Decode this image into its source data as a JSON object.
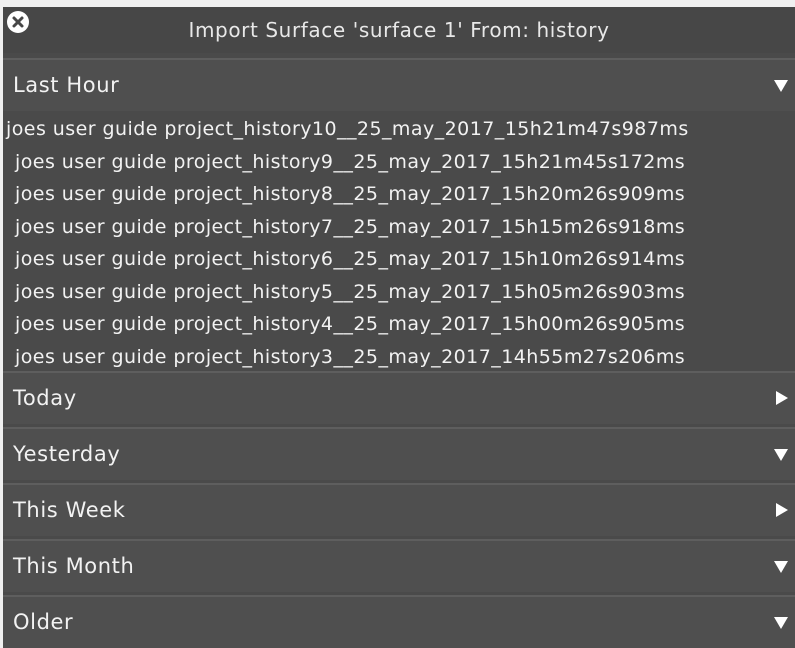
{
  "dialog": {
    "title": "Import Surface 'surface 1' From: history",
    "close_icon": "close-circle-icon"
  },
  "sections": [
    {
      "label": "Last Hour",
      "expanded": true,
      "arrow_icon": "triangle-down-icon",
      "items": [
        "joes user guide project_history10__25_may_2017_15h21m47s987ms",
        "joes user guide project_history9__25_may_2017_15h21m45s172ms",
        "joes user guide project_history8__25_may_2017_15h20m26s909ms",
        "joes user guide project_history7__25_may_2017_15h15m26s918ms",
        "joes user guide project_history6__25_may_2017_15h10m26s914ms",
        "joes user guide project_history5__25_may_2017_15h05m26s903ms",
        "joes user guide project_history4__25_may_2017_15h00m26s905ms",
        "joes user guide project_history3__25_may_2017_14h55m27s206ms"
      ]
    },
    {
      "label": "Today",
      "expanded": false,
      "arrow_icon": "triangle-right-icon"
    },
    {
      "label": "Yesterday",
      "expanded": true,
      "arrow_icon": "triangle-down-icon"
    },
    {
      "label": "This Week",
      "expanded": false,
      "arrow_icon": "triangle-right-icon"
    },
    {
      "label": "This Month",
      "expanded": true,
      "arrow_icon": "triangle-down-icon"
    },
    {
      "label": "Older",
      "expanded": true,
      "arrow_icon": "triangle-down-icon"
    }
  ],
  "colors": {
    "panel_background": "#4a4a4a",
    "header_background": "#4f4f4f",
    "separator": "#5e5e5e",
    "text": "#f2f2f2"
  }
}
